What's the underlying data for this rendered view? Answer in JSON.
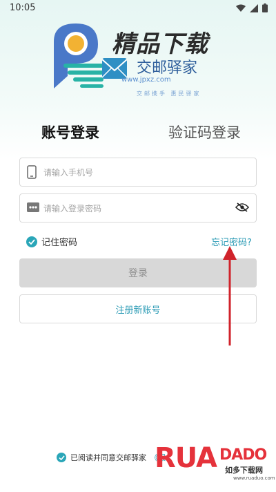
{
  "status_bar": {
    "time": "10:05"
  },
  "logo": {
    "big_text": "精品下载",
    "app_name": "交邮驿家",
    "url": "www.jpxz.com",
    "slogan": "交邮携手  惠民驿家"
  },
  "tabs": {
    "account_login": "账号登录",
    "code_login": "验证码登录"
  },
  "form": {
    "phone_placeholder": "请输入手机号",
    "password_placeholder": "请输入登录密码"
  },
  "remember_password": "记住密码",
  "forgot_password": "忘记密码?",
  "login_button": "登录",
  "register_button": "注册新账号",
  "agreement_text": "已阅读并同意交邮驿家",
  "agreement_link": "《服",
  "watermark": {
    "main": "RUA",
    "tail": "DADO",
    "sub": "如多下载网",
    "url": "www.ruaduo.com"
  },
  "colors": {
    "accent": "#2aa6b8",
    "arrow": "#d0232b",
    "watermark": "#e5323b"
  }
}
